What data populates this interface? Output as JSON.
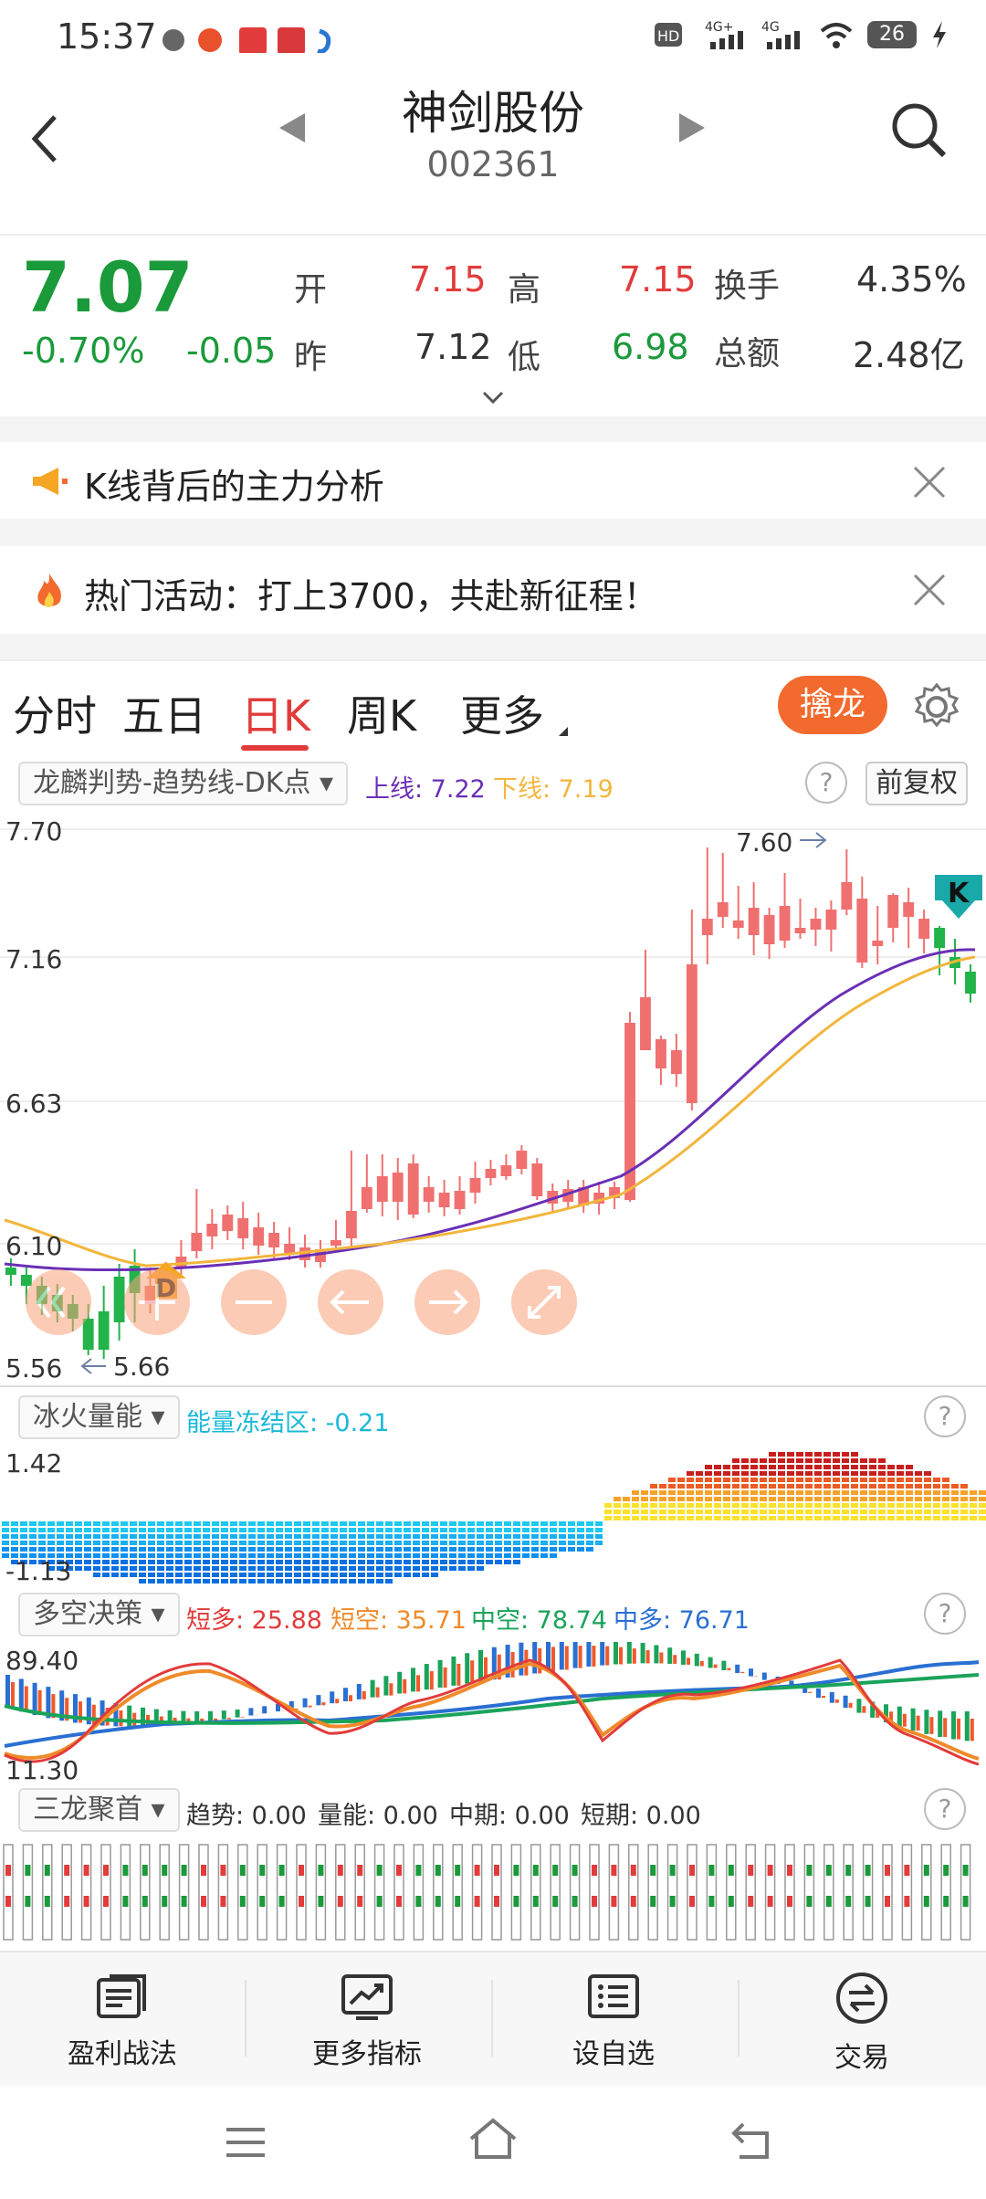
{
  "status": {
    "time": "15:37",
    "battery": "26",
    "net1": "4G",
    "net2": "4G"
  },
  "header": {
    "title": "神剑股份",
    "code": "002361"
  },
  "quote": {
    "price": "7.07",
    "pct": "-0.70%",
    "chg": "-0.05",
    "open_label": "开",
    "open": "7.15",
    "high_label": "高",
    "high": "7.15",
    "prev_label": "昨",
    "prev": "7.12",
    "low_label": "低",
    "low": "6.98",
    "turnover_label": "换手",
    "turnover": "4.35%",
    "amount_label": "总额",
    "amount": "2.48亿"
  },
  "banners": [
    {
      "text": "K线背后的主力分析"
    },
    {
      "text": "热门活动：打上3700，共赴新征程！"
    }
  ],
  "tabs": [
    {
      "label": "分时"
    },
    {
      "label": "五日"
    },
    {
      "label": "日K"
    },
    {
      "label": "周K"
    },
    {
      "label": "更多"
    }
  ],
  "qinlong_label": "擒龙",
  "kline": {
    "indicator": "龙麟判势-趋势线-DK点",
    "upper": "上线: 7.22",
    "lower": "下线: 7.19",
    "fuquan": "前复权",
    "axis": [
      "7.70",
      "7.16",
      "6.63",
      "6.10",
      "5.56"
    ],
    "max_label": "7.60",
    "min_label": "5.66",
    "d_label": "D",
    "k_label": "K"
  },
  "energy": {
    "indicator": "冰火量能",
    "freeze": "能量冻结区: -0.21",
    "axis": [
      "1.42",
      "-1.13"
    ]
  },
  "duokong": {
    "indicator": "多空决策",
    "items": [
      "短多: 25.88",
      "短空: 35.71",
      "中空: 78.74",
      "中多: 76.71"
    ],
    "axis": [
      "89.40",
      "11.30"
    ]
  },
  "sanlong": {
    "indicator": "三龙聚首",
    "items": [
      "趋势: 0.00",
      "量能: 0.00",
      "中期: 0.00",
      "短期: 0.00"
    ]
  },
  "bottom_nav": [
    {
      "label": "盈利战法"
    },
    {
      "label": "更多指标"
    },
    {
      "label": "设自选"
    },
    {
      "label": "交易"
    }
  ],
  "colors": {
    "red": "#e23b3b",
    "green": "#1a9a3a",
    "accent": "#f26a2e",
    "purple": "#6a2fb5",
    "yellow": "#f2b63c"
  }
}
